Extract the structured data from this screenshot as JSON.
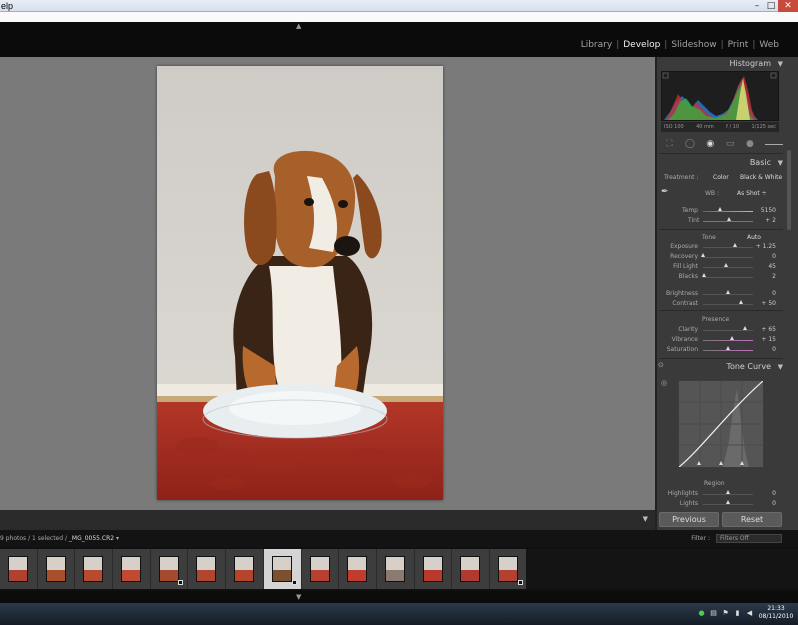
{
  "window": {
    "menu_fragment": "elp",
    "buttons": {
      "minimize": "–",
      "maximize": "□",
      "close": "✕"
    }
  },
  "modules": [
    "Library",
    "Develop",
    "Slideshow",
    "Print",
    "Web"
  ],
  "active_module": "Develop",
  "histogram": {
    "title": "Histogram",
    "iso": "ISO 100",
    "focal": "40 mm",
    "aperture": "f / 10",
    "shutter": "1/125 sec"
  },
  "basic": {
    "title": "Basic",
    "treatment_label": "Treatment :",
    "color_btn": "Color",
    "bw_btn": "Black & White",
    "wb_label": "WB :",
    "wb_value": "As Shot ÷",
    "temp": {
      "label": "Temp",
      "value": "5150",
      "pos": 0.33
    },
    "tint": {
      "label": "Tint",
      "value": "+ 2",
      "pos": 0.51
    },
    "tone_label": "Tone",
    "auto_label": "Auto",
    "exposure": {
      "label": "Exposure",
      "value": "+ 1.25",
      "pos": 0.63
    },
    "recovery": {
      "label": "Recovery",
      "value": "0",
      "pos": 0.0
    },
    "fill_light": {
      "label": "Fill Light",
      "value": "45",
      "pos": 0.45
    },
    "blacks": {
      "label": "Blacks",
      "value": "2",
      "pos": 0.02
    },
    "brightness": {
      "label": "Brightness",
      "value": "0",
      "pos": 0.5
    },
    "contrast": {
      "label": "Contrast",
      "value": "+ 50",
      "pos": 0.75
    },
    "presence_label": "Presence",
    "clarity": {
      "label": "Clarity",
      "value": "+ 65",
      "pos": 0.83
    },
    "vibrance": {
      "label": "Vibrance",
      "value": "+ 15",
      "pos": 0.58
    },
    "saturation": {
      "label": "Saturation",
      "value": "0",
      "pos": 0.5
    }
  },
  "tone_curve": {
    "title": "Tone Curve",
    "region_label": "Region",
    "highlights": {
      "label": "Highlights",
      "value": "0",
      "pos": 0.5
    },
    "lights": {
      "label": "Lights",
      "value": "0",
      "pos": 0.5
    }
  },
  "buttons": {
    "previous": "Previous",
    "reset": "Reset"
  },
  "filmstrip": {
    "info_prefix": "9 photos / 1 selected /",
    "filename": "_MG_0055.CR2",
    "filter_label": "Filter :",
    "filter_value": "Filters Off"
  },
  "taskbar": {
    "time": "21:33",
    "date": "08/11/2010"
  },
  "colors": {
    "panel": "#3a3a3a",
    "view": "#7a7a7a",
    "accent": "#c84a3c"
  }
}
